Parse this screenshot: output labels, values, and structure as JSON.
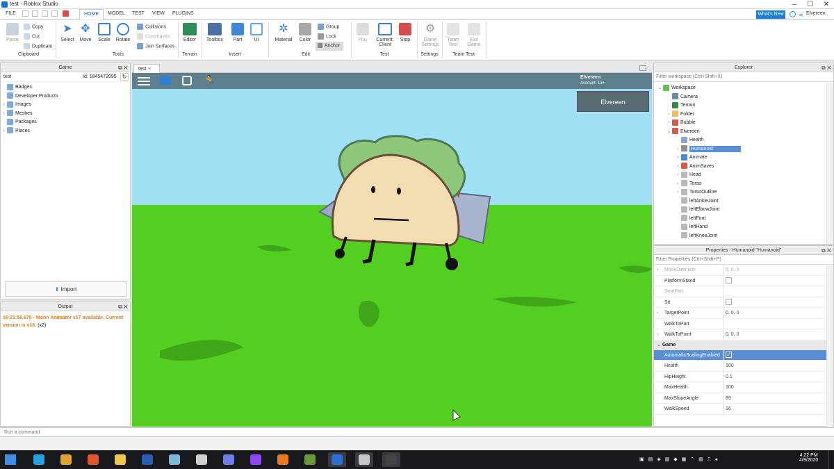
{
  "window": {
    "title": "test - Roblox Studio"
  },
  "menubar": {
    "items": [
      "FILE",
      "HOME",
      "MODEL",
      "TEST",
      "VIEW",
      "PLUGINS"
    ],
    "active": "HOME"
  },
  "header_right": {
    "whats_new": "What's New",
    "user": "Elvereen"
  },
  "ribbon": {
    "clipboard": {
      "paste": "Paste",
      "copy": "Copy",
      "cut": "Cut",
      "duplicate": "Duplicate",
      "label": "Clipboard"
    },
    "tools": {
      "select": "Select",
      "move": "Move",
      "scale": "Scale",
      "rotate": "Rotate",
      "collisions": "Collisions",
      "constraints": "Constraints",
      "join_surfaces": "Join Surfaces",
      "label": "Tools"
    },
    "terrain": {
      "editor": "Editor",
      "label": "Terrain"
    },
    "insert": {
      "toolbox": "Toolbox",
      "part": "Part",
      "ui": "UI",
      "label": "Insert"
    },
    "edit": {
      "material": "Material",
      "color": "Color",
      "group": "Group",
      "lock": "Lock",
      "anchor": "Anchor",
      "label": "Edit"
    },
    "test": {
      "play": "Play",
      "current_client_1": "Current:",
      "current_client_2": "Client",
      "stop": "Stop",
      "label": "Test"
    },
    "settings": {
      "game_settings_1": "Game",
      "game_settings_2": "Settings",
      "label": "Settings"
    },
    "team_test": {
      "team_test_1": "Team",
      "team_test_2": "Test",
      "exit_game_1": "Exit",
      "exit_game_2": "Game",
      "label": "Team Test"
    }
  },
  "game_panel": {
    "title": "Game",
    "place_name": "test",
    "place_id": "Id: 1845472095",
    "items": [
      {
        "label": "Badges",
        "expandable": false
      },
      {
        "label": "Developer Products",
        "expandable": false
      },
      {
        "label": "Images",
        "expandable": true
      },
      {
        "label": "Meshes",
        "expandable": true
      },
      {
        "label": "Packages",
        "expandable": false
      },
      {
        "label": "Places",
        "expandable": true
      }
    ],
    "import_label": "Import"
  },
  "output_panel": {
    "title": "Output",
    "message": "16:21:56.670 - Moon Animator v17 available. Current version is v16.",
    "count": "(x2)"
  },
  "viewport": {
    "tab": "test",
    "player_name": "Elvereen",
    "account": "Account: 13+",
    "name_button": "Elvereen"
  },
  "explorer": {
    "title": "Explorer",
    "filter_placeholder": "Filter workspace (Ctrl+Shift+X)",
    "rows": [
      {
        "label": "Workspace",
        "indent": 0,
        "arrow": "v",
        "icon": "globe",
        "color": "#6fb85a"
      },
      {
        "label": "Camera",
        "indent": 1,
        "arrow": "",
        "icon": "camera",
        "color": "#6c8aa3"
      },
      {
        "label": "Terrain",
        "indent": 1,
        "arrow": "",
        "icon": "terrain",
        "color": "#2f8a44"
      },
      {
        "label": "Folder",
        "indent": 1,
        "arrow": ">",
        "icon": "folder",
        "color": "#e7c35a"
      },
      {
        "label": "Bubble",
        "indent": 1,
        "arrow": ">",
        "icon": "model",
        "color": "#d45a4a"
      },
      {
        "label": "Elvereen",
        "indent": 1,
        "arrow": "v",
        "icon": "model",
        "color": "#d45a4a"
      },
      {
        "label": "Health",
        "indent": 2,
        "arrow": "",
        "icon": "script",
        "color": "#8aa6c8"
      },
      {
        "label": "Humanoid",
        "indent": 2,
        "arrow": ">",
        "icon": "humanoid",
        "color": "#8f8f8f",
        "selected": true
      },
      {
        "label": "Animate",
        "indent": 2,
        "arrow": ">",
        "icon": "script",
        "color": "#4a8ad4"
      },
      {
        "label": "AnimSaves",
        "indent": 2,
        "arrow": ">",
        "icon": "model",
        "color": "#d45a4a"
      },
      {
        "label": "Head",
        "indent": 2,
        "arrow": ">",
        "icon": "part",
        "color": "#b9b9b9"
      },
      {
        "label": "Torso",
        "indent": 2,
        "arrow": ">",
        "icon": "part",
        "color": "#b9b9b9"
      },
      {
        "label": "TorsoOutline",
        "indent": 2,
        "arrow": ">",
        "icon": "part",
        "color": "#b9b9b9"
      },
      {
        "label": "leftAnkleJoint",
        "indent": 2,
        "arrow": "",
        "icon": "part",
        "color": "#b9b9b9"
      },
      {
        "label": "leftElbowJoint",
        "indent": 2,
        "arrow": "",
        "icon": "part",
        "color": "#b9b9b9"
      },
      {
        "label": "leftFoot",
        "indent": 2,
        "arrow": "",
        "icon": "part",
        "color": "#b9b9b9"
      },
      {
        "label": "leftHand",
        "indent": 2,
        "arrow": "",
        "icon": "part",
        "color": "#b9b9b9"
      },
      {
        "label": "leftKneeJoint",
        "indent": 2,
        "arrow": "",
        "icon": "part",
        "color": "#b9b9b9"
      }
    ]
  },
  "properties": {
    "title": "Properties - Humanoid \"Humanoid\"",
    "filter_placeholder": "Filter Properties (Ctrl+Shift+P)",
    "rows": [
      {
        "name": "MoveDirection",
        "value": "0, 0, 0",
        "dim": true,
        "arrow": true
      },
      {
        "name": "PlatformStand",
        "value": "",
        "checkbox": "off"
      },
      {
        "name": "SeatPart",
        "value": "",
        "dim": true
      },
      {
        "name": "Sit",
        "value": "",
        "checkbox": "off"
      },
      {
        "name": "TargetPoint",
        "value": "0, 0, 0",
        "arrow": true
      },
      {
        "name": "WalkToPart",
        "value": ""
      },
      {
        "name": "WalkToPoint",
        "value": "0, 0, 0",
        "arrow": true
      }
    ],
    "group": "Game",
    "game_rows": [
      {
        "name": "AutomaticScalingEnabled",
        "value": "",
        "checkbox": "on",
        "selected": true
      },
      {
        "name": "Health",
        "value": "100"
      },
      {
        "name": "HipHeight",
        "value": "0.1"
      },
      {
        "name": "MaxHealth",
        "value": "100"
      },
      {
        "name": "MaxSlopeAngle",
        "value": "89"
      },
      {
        "name": "WalkSpeed",
        "value": "16"
      }
    ]
  },
  "command_bar": {
    "placeholder": "Run a command"
  },
  "taskbar": {
    "time": "4:22 PM",
    "date": "4/9/2020",
    "apps": [
      "start-icon",
      "ie-icon",
      "chrome-icon",
      "firefox-icon",
      "explorer-icon",
      "word-icon",
      "notes-icon",
      "games-icon",
      "discord-icon",
      "twitch-icon",
      "media-icon",
      "minecraft-icon",
      "roblox-studio-icon",
      "roblox-icon",
      "obs-icon"
    ]
  }
}
